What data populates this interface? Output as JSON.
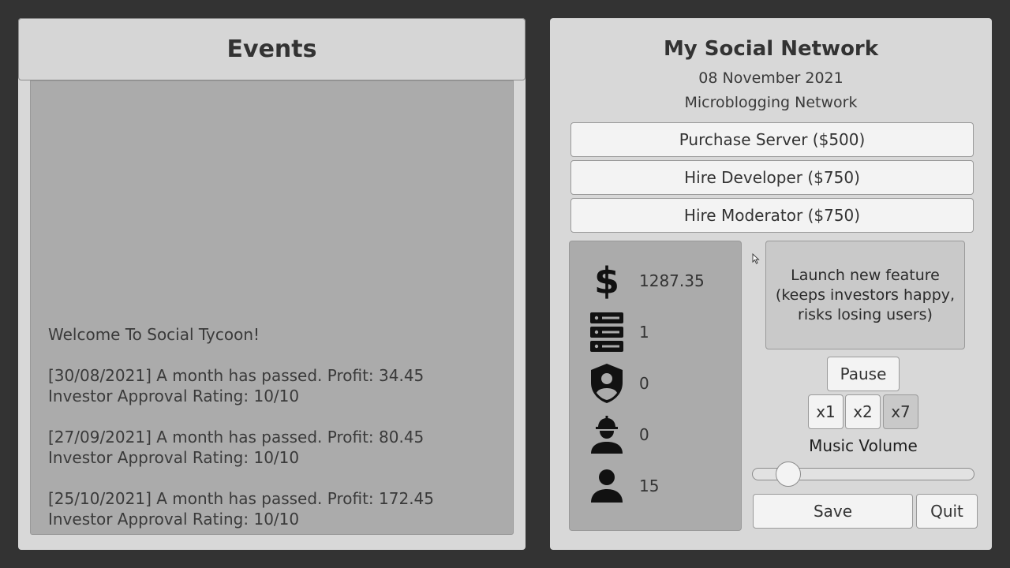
{
  "events": {
    "title": "Events",
    "welcome": "Welcome To Social Tycoon!",
    "entries": [
      {
        "line1": "[30/08/2021] A month has passed. Profit: 34.45",
        "line2": "Investor Approval Rating: 10/10"
      },
      {
        "line1": "[27/09/2021] A month has passed. Profit: 80.45",
        "line2": "Investor Approval Rating: 10/10"
      },
      {
        "line1": "[25/10/2021] A month has passed. Profit: 172.45",
        "line2": "Investor Approval Rating: 10/10"
      }
    ]
  },
  "network": {
    "name": "My Social Network",
    "date": "08 November 2021",
    "type": "Microblogging Network"
  },
  "actions": {
    "purchase_server": "Purchase Server ($500)",
    "hire_developer": "Hire Developer ($750)",
    "hire_moderator": "Hire Moderator ($750)",
    "launch_feature": "Launch new feature (keeps investors happy, risks losing users)"
  },
  "stats": {
    "money": "1287.35",
    "servers": "1",
    "moderators": "0",
    "developers": "0",
    "users": "15",
    "icons": [
      "dollar-icon",
      "server-icon",
      "moderator-shield-icon",
      "developer-icon",
      "user-icon"
    ]
  },
  "controls": {
    "pause": "Pause",
    "speed_options": [
      "x1",
      "x2",
      "x7"
    ],
    "selected_speed": "x7",
    "music_label": "Music Volume",
    "music_volume": 0.12,
    "save": "Save",
    "quit": "Quit"
  }
}
